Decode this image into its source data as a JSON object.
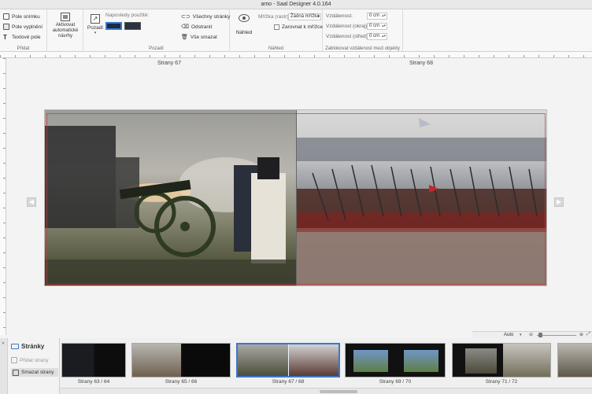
{
  "window": {
    "title": "amo - Saal Designer 4.0.164"
  },
  "ribbon": {
    "add_group": {
      "label": "Přidat",
      "items": [
        "Pole snímku",
        "Pole vyplnění",
        "Textové pole"
      ]
    },
    "auto_group": {
      "label_line1": "Aktivovat",
      "label_line2": "automatické",
      "label_line3": "návrhy"
    },
    "background_group": {
      "label": "Pozadí",
      "button": "Pozadí",
      "recent_label": "Naposledy použité:",
      "actions": [
        "Všechny stránky",
        "Odstranit",
        "Vše smazat"
      ]
    },
    "preview_group": {
      "label": "Náhled",
      "preview_button": "Náhled",
      "grid_label": "Mřížka (rastr):",
      "grid_value": "Žádná mřížka",
      "snap_label": "Zarovnat k mřížce"
    },
    "distance_group": {
      "label": "Zablokovat vzdálenost mezi objekty",
      "rows": [
        {
          "label": "Vzdálenost:",
          "value": "0 cm"
        },
        {
          "label": "Vzdálenost (okraj):",
          "value": "0 cm"
        },
        {
          "label": "Vzdálenost (střed):",
          "value": "0 cm"
        }
      ]
    }
  },
  "canvas": {
    "left_page": "Strany 67",
    "right_page": "Strany 68"
  },
  "zoom": {
    "value": "Auto"
  },
  "pages_panel": {
    "title": "Stránky",
    "add_button": "Přidat strany",
    "delete_button": "Smazat strany"
  },
  "thumbnails": [
    {
      "label": "Strany 63 / 64"
    },
    {
      "label": "Strany 65 / 66"
    },
    {
      "label": "Strany 67 / 68"
    },
    {
      "label": "Strany 69 / 70"
    },
    {
      "label": "Strany 71 / 72"
    }
  ],
  "colors": {
    "accent": "#3a78c9",
    "swatch_selected": "#1c2a44",
    "swatch_other": "#2b3240"
  }
}
